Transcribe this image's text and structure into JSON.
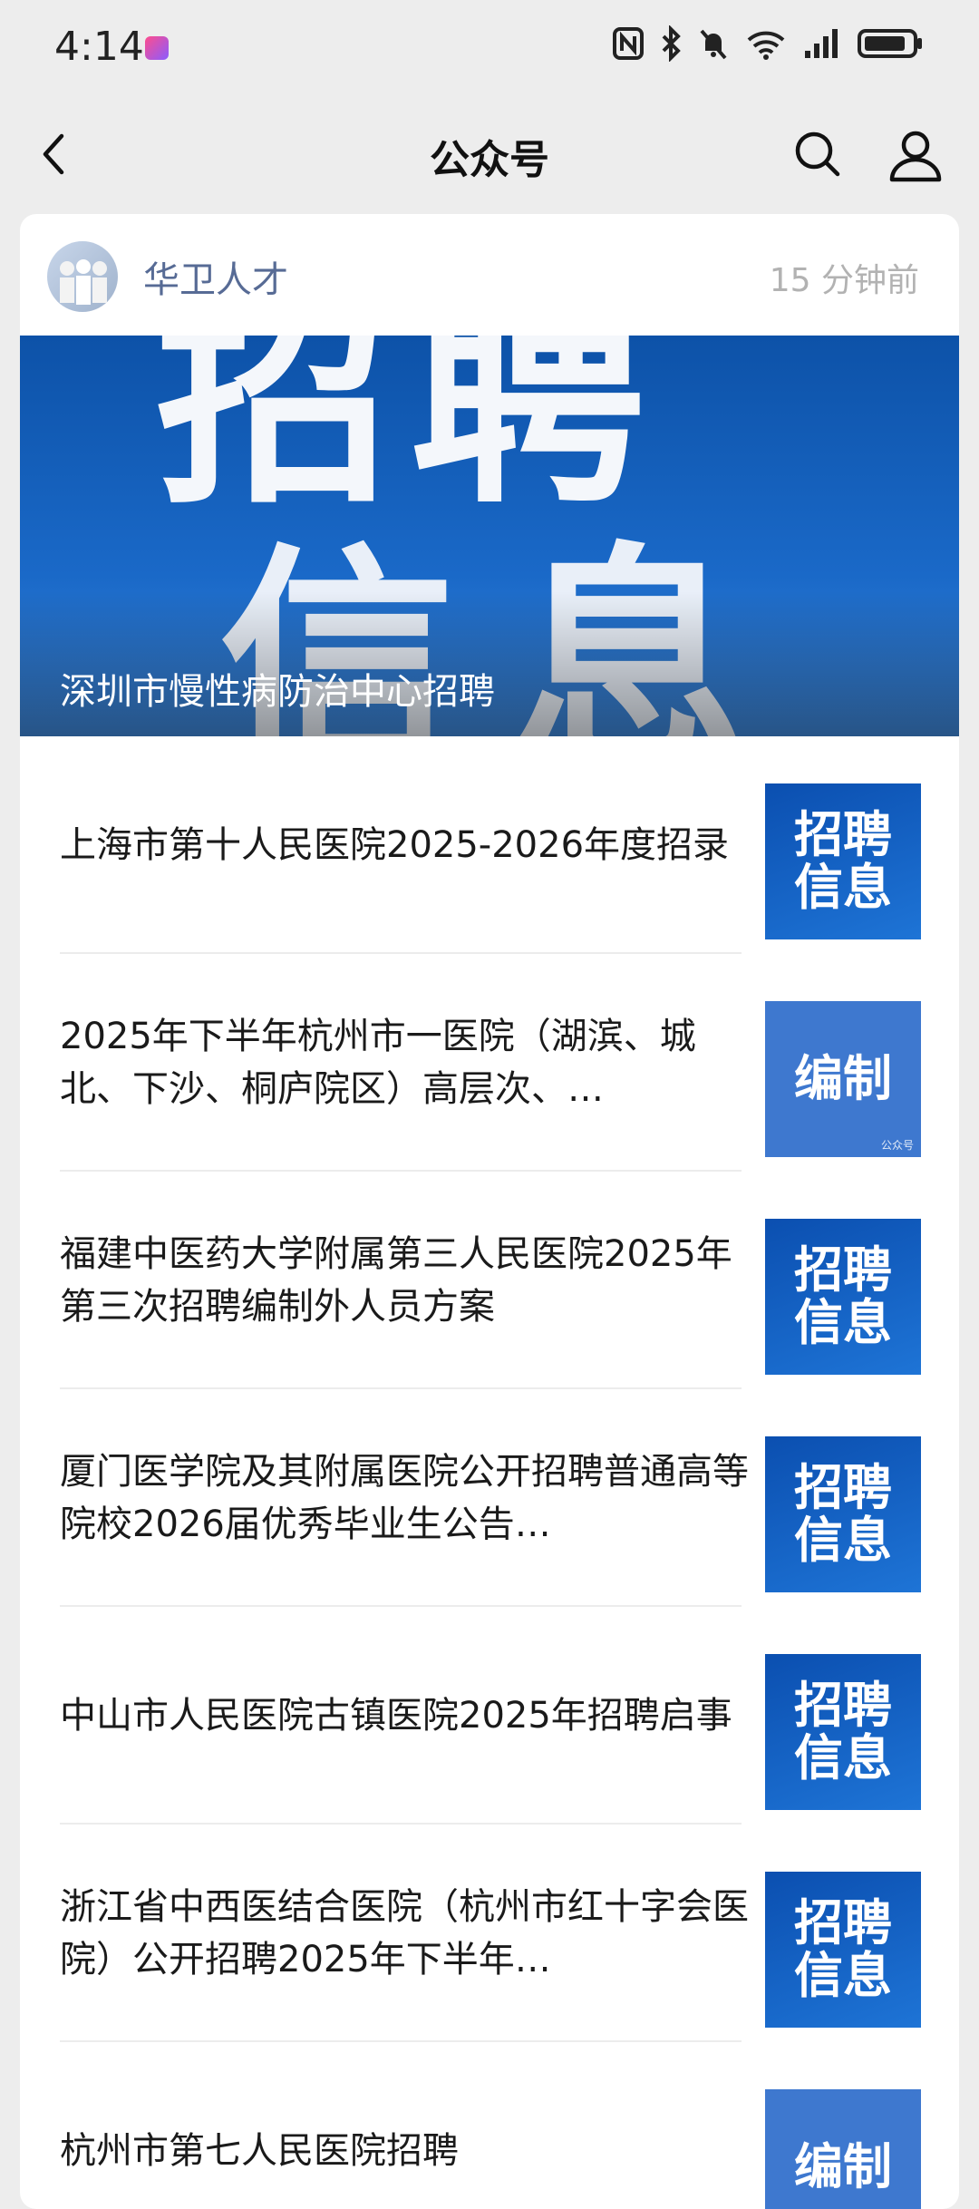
{
  "status_bar": {
    "time": "4:14"
  },
  "nav": {
    "title": "公众号"
  },
  "account": {
    "name": "华卫人才",
    "time": "15 分钟前"
  },
  "hero": {
    "big_line1": "招聘",
    "big_line2": "信息",
    "title": "深圳市慢性病防治中心招聘"
  },
  "articles": [
    {
      "title": "上海市第十人民医院2025-2026年度招录",
      "thumb_line1": "招聘",
      "thumb_line2": "信息",
      "thumb_wm": ""
    },
    {
      "title": "2025年下半年杭州市一医院（湖滨、城北、下沙、桐庐院区）高层次、…",
      "thumb_line1": "编制",
      "thumb_line2": "",
      "thumb_wm": "公众号"
    },
    {
      "title": "福建中医药大学附属第三人民医院2025年第三次招聘编制外人员方案",
      "thumb_line1": "招聘",
      "thumb_line2": "信息",
      "thumb_wm": ""
    },
    {
      "title": "厦门医学院及其附属医院公开招聘普通高等院校2026届优秀毕业生公告…",
      "thumb_line1": "招聘",
      "thumb_line2": "信息",
      "thumb_wm": ""
    },
    {
      "title": "中山市人民医院古镇医院2025年招聘启事",
      "thumb_line1": "招聘",
      "thumb_line2": "信息",
      "thumb_wm": ""
    },
    {
      "title": "浙江省中西医结合医院（杭州市红十字会医院）公开招聘2025年下半年…",
      "thumb_line1": "招聘",
      "thumb_line2": "信息",
      "thumb_wm": ""
    },
    {
      "title": "杭州市第七人民医院招聘",
      "thumb_line1": "编制",
      "thumb_line2": "",
      "thumb_wm": ""
    }
  ]
}
